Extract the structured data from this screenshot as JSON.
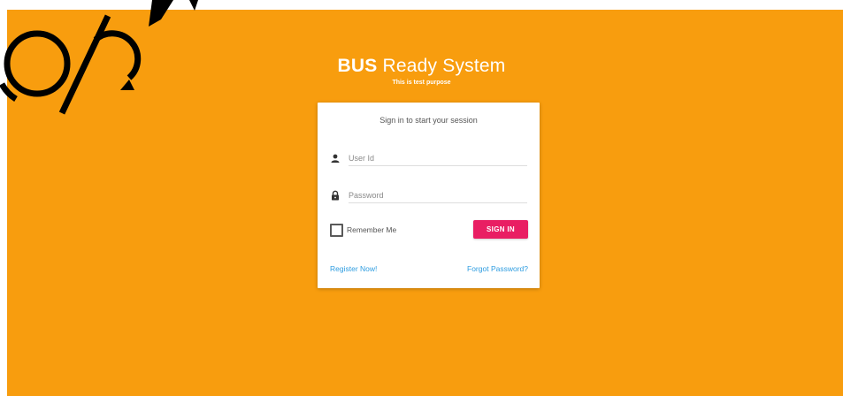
{
  "brand": {
    "title_bold": "BUS",
    "title_rest": " Ready System",
    "subtitle": "This is test purpose"
  },
  "login": {
    "message": "Sign in to start your session",
    "username": {
      "placeholder": "User Id",
      "value": ""
    },
    "password": {
      "placeholder": "Password",
      "value": ""
    },
    "remember_label": "Remember Me",
    "remember_checked": false,
    "signin_label": "SIGN IN",
    "register_link": "Register Now!",
    "forgot_link": "Forgot Password?"
  },
  "icons": {
    "user": "person-icon",
    "password": "lock-icon"
  },
  "colors": {
    "background": "#f89d0e",
    "card": "#ffffff",
    "signin_button": "#e91e63",
    "link": "#2f9de0",
    "watermark": "#000000"
  }
}
